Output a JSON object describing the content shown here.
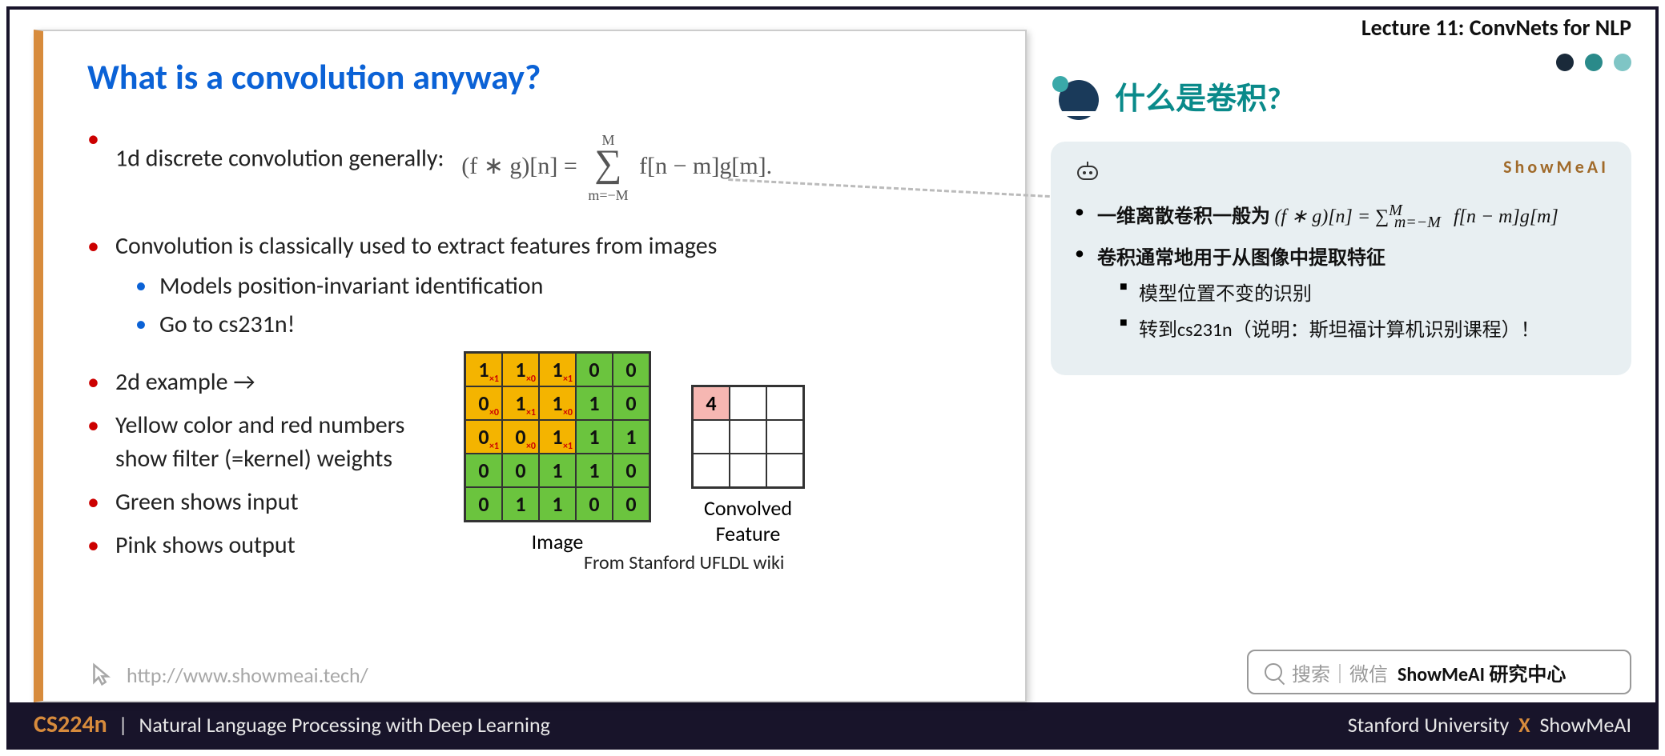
{
  "lecture_label": "Lecture 11: ConvNets for NLP",
  "slide": {
    "title": "What is a convolution anyway?",
    "bullets": {
      "b1": "1d discrete convolution generally:",
      "formula": {
        "lhs": "(f ∗ g)[n] =",
        "upper": "M",
        "lower": "m=−M",
        "rhs": "f[n − m]g[m]."
      },
      "b2": "Convolution is classically used to extract features from images",
      "b2a": "Models position-invariant identification",
      "b2b": "Go to cs231n!",
      "b3": "2d example →",
      "b4": "Yellow color and red numbers show filter (=kernel) weights",
      "b5": "Green shows input",
      "b6": "Pink shows output"
    },
    "image_label": "Image",
    "feature_label_1": "Convolved",
    "feature_label_2": "Feature",
    "credit": "From Stanford UFLDL wiki",
    "footer_url": "http://www.showmeai.tech/"
  },
  "chart_data": {
    "type": "table",
    "description": "2D convolution example: 5x5 input image, 3x3 kernel overlay (top-left), 3x3 output",
    "input_matrix": [
      [
        1,
        1,
        1,
        0,
        0
      ],
      [
        0,
        1,
        1,
        1,
        0
      ],
      [
        0,
        0,
        1,
        1,
        1
      ],
      [
        0,
        0,
        1,
        1,
        0
      ],
      [
        0,
        1,
        1,
        0,
        0
      ]
    ],
    "kernel_overlay_rows": 3,
    "kernel_overlay_cols": 3,
    "kernel_weights": [
      [
        1,
        0,
        1
      ],
      [
        0,
        1,
        0
      ],
      [
        1,
        0,
        1
      ]
    ],
    "output_matrix": [
      [
        4,
        null,
        null
      ],
      [
        null,
        null,
        null
      ],
      [
        null,
        null,
        null
      ]
    ],
    "colors": {
      "input": "#6bc43e",
      "kernel_overlay": "#f4b400",
      "output_filled": "#f6b7b2"
    }
  },
  "cn_title": "什么是卷积?",
  "note": {
    "brand": "ShowMeAI",
    "li1_a": "一维离散卷积一般为",
    "li1_b": "(f ∗ g)[n] = ∑",
    "li1_sup": "M",
    "li1_sub": "m=−M",
    "li1_c": " f[n − m]g[m]",
    "li2": "卷积通常地用于从图像中提取特征",
    "li2a": "模型位置不变的识别",
    "li2b": "转到cs231n（说明：斯坦福计算机识别课程）！"
  },
  "search": {
    "placeholder": "搜索｜微信",
    "brand": "ShowMeAI 研究中心"
  },
  "footer": {
    "course": "CS224n",
    "subtitle": "Natural Language Processing with Deep Learning",
    "right_a": "Stanford University",
    "right_b": "ShowMeAI"
  }
}
